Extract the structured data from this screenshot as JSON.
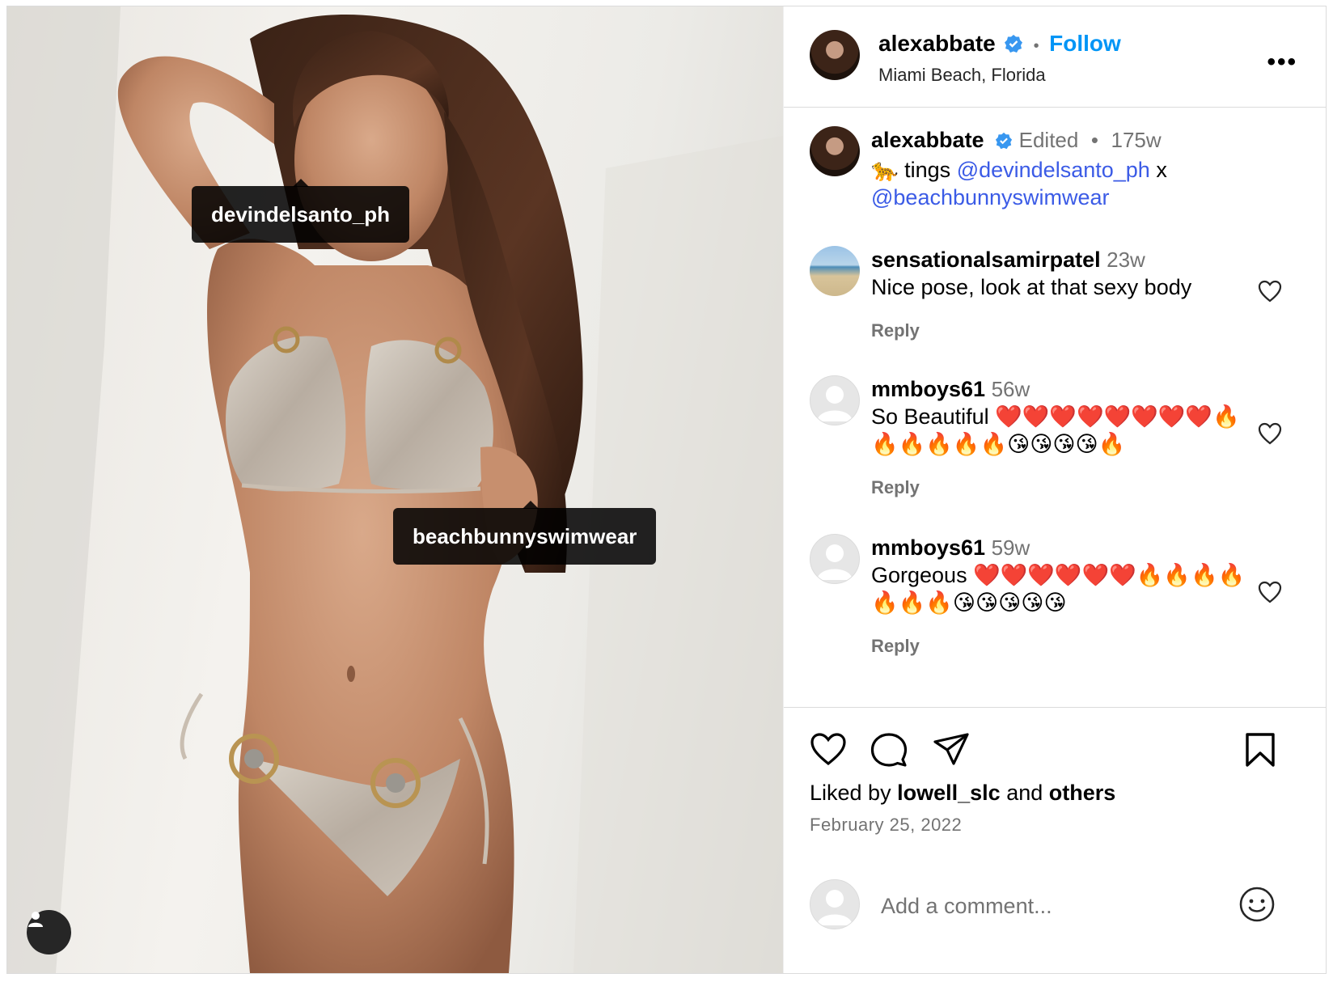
{
  "post": {
    "tags": [
      "devindelsanto_ph",
      "beachbunnyswimwear"
    ]
  },
  "header": {
    "username": "alexabbate",
    "separator": "•",
    "follow_label": "Follow",
    "location": "Miami Beach, Florida",
    "more_label": "•••"
  },
  "caption": {
    "username": "alexabbate",
    "edited_label": "Edited",
    "separator": "•",
    "time": "175w",
    "emoji": "🐆",
    "text": "tings",
    "mention_1": "@devindelsanto_ph",
    "joiner": "x",
    "mention_2": "@beachbunnyswimwear"
  },
  "comments": [
    {
      "username": "sensationalsamirpatel",
      "time": "23w",
      "text": "Nice pose, look at that sexy body",
      "reply_label": "Reply"
    },
    {
      "username": "mmboys61",
      "time": "56w",
      "text": "So Beautiful ❤️❤️❤️❤️❤️❤️❤️❤️🔥🔥🔥🔥🔥🔥😘😘😘😘🔥",
      "reply_label": "Reply"
    },
    {
      "username": "mmboys61",
      "time": "59w",
      "text": "Gorgeous ❤️❤️❤️❤️❤️❤️🔥🔥🔥🔥🔥🔥🔥😘😘😘😘😘",
      "reply_label": "Reply"
    }
  ],
  "actions": {
    "liked_prefix": "Liked by",
    "liked_user": "lowell_slc",
    "liked_and": "and",
    "liked_others": "others",
    "date": "February 25, 2022"
  },
  "composer": {
    "placeholder": "Add a comment..."
  },
  "colors": {
    "accent": "#0095f6",
    "verified": "#3897f0",
    "mention": "#3b5be6",
    "muted": "#737373"
  }
}
